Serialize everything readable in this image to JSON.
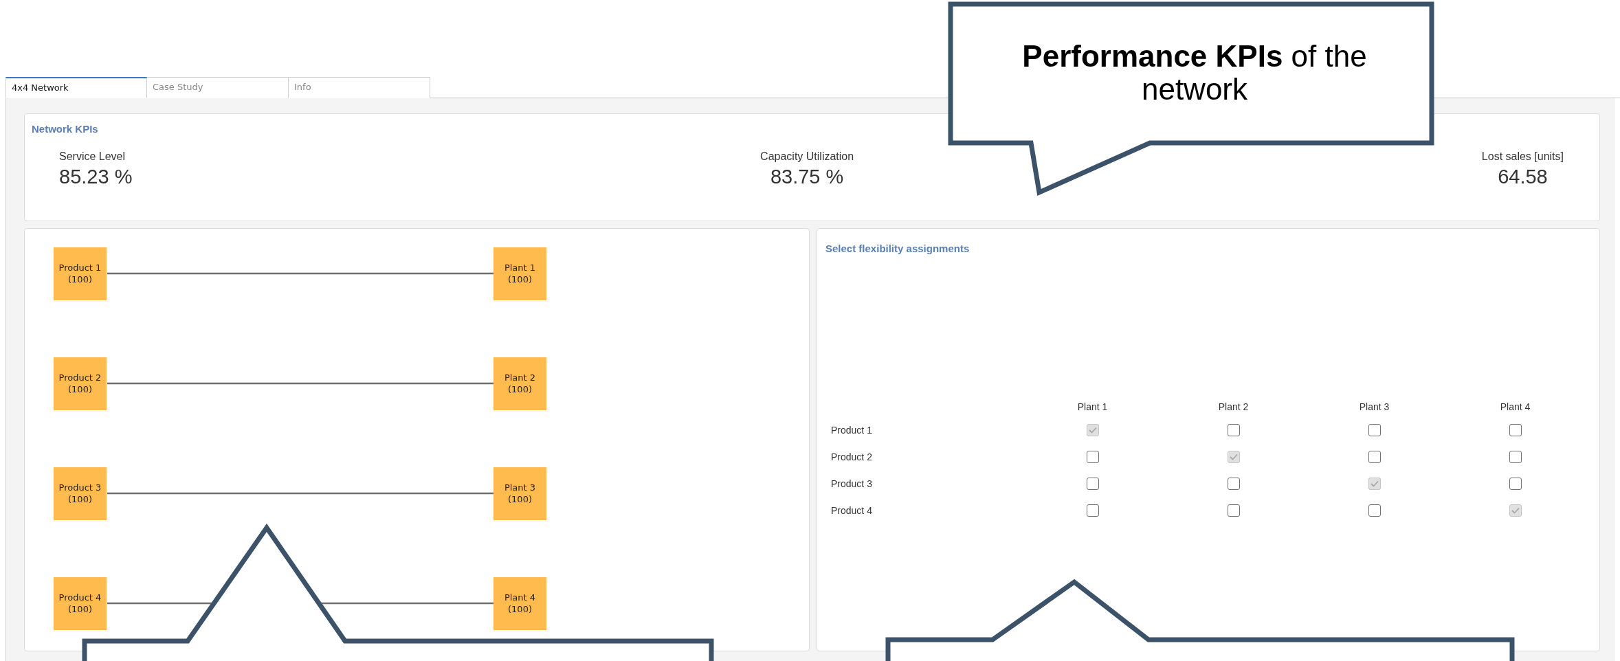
{
  "tabs": [
    {
      "label": "4x4 Network",
      "selected": true
    },
    {
      "label": "Case Study",
      "selected": false
    },
    {
      "label": "Info",
      "selected": false
    }
  ],
  "kpi_panel": {
    "title": "Network KPIs",
    "kpis": [
      {
        "label": "Service Level",
        "value": "85.23 %"
      },
      {
        "label": "Capacity Utilization",
        "value": "83.75 %"
      },
      {
        "label": "Lost sales [units]",
        "value": "64.58"
      }
    ]
  },
  "network_diagram": {
    "rows": [
      {
        "product": {
          "name": "Product 1",
          "capacity": "(100)"
        },
        "plant": {
          "name": "Plant 1",
          "capacity": "(100)"
        }
      },
      {
        "product": {
          "name": "Product 2",
          "capacity": "(100)"
        },
        "plant": {
          "name": "Plant 2",
          "capacity": "(100)"
        }
      },
      {
        "product": {
          "name": "Product 3",
          "capacity": "(100)"
        },
        "plant": {
          "name": "Plant 3",
          "capacity": "(100)"
        }
      },
      {
        "product": {
          "name": "Product 4",
          "capacity": "(100)"
        },
        "plant": {
          "name": "Plant 4",
          "capacity": "(100)"
        }
      }
    ]
  },
  "assignments": {
    "title": "Select flexibility assignments",
    "columns": [
      "Plant 1",
      "Plant 2",
      "Plant 3",
      "Plant 4"
    ],
    "rows": [
      {
        "label": "Product 1",
        "cells": [
          {
            "checked": true,
            "disabled": true
          },
          {
            "checked": false,
            "disabled": false
          },
          {
            "checked": false,
            "disabled": false
          },
          {
            "checked": false,
            "disabled": false
          }
        ]
      },
      {
        "label": "Product 2",
        "cells": [
          {
            "checked": false,
            "disabled": false
          },
          {
            "checked": true,
            "disabled": true
          },
          {
            "checked": false,
            "disabled": false
          },
          {
            "checked": false,
            "disabled": false
          }
        ]
      },
      {
        "label": "Product 3",
        "cells": [
          {
            "checked": false,
            "disabled": false
          },
          {
            "checked": false,
            "disabled": false
          },
          {
            "checked": true,
            "disabled": true
          },
          {
            "checked": false,
            "disabled": false
          }
        ]
      },
      {
        "label": "Product 4",
        "cells": [
          {
            "checked": false,
            "disabled": false
          },
          {
            "checked": false,
            "disabled": false
          },
          {
            "checked": false,
            "disabled": false
          },
          {
            "checked": true,
            "disabled": true
          }
        ]
      }
    ]
  },
  "callouts": [
    {
      "kind": "top",
      "text": "**Performance KPIs** of the network"
    },
    {
      "kind": "bottom-left"
    },
    {
      "kind": "bottom-right"
    }
  ]
}
